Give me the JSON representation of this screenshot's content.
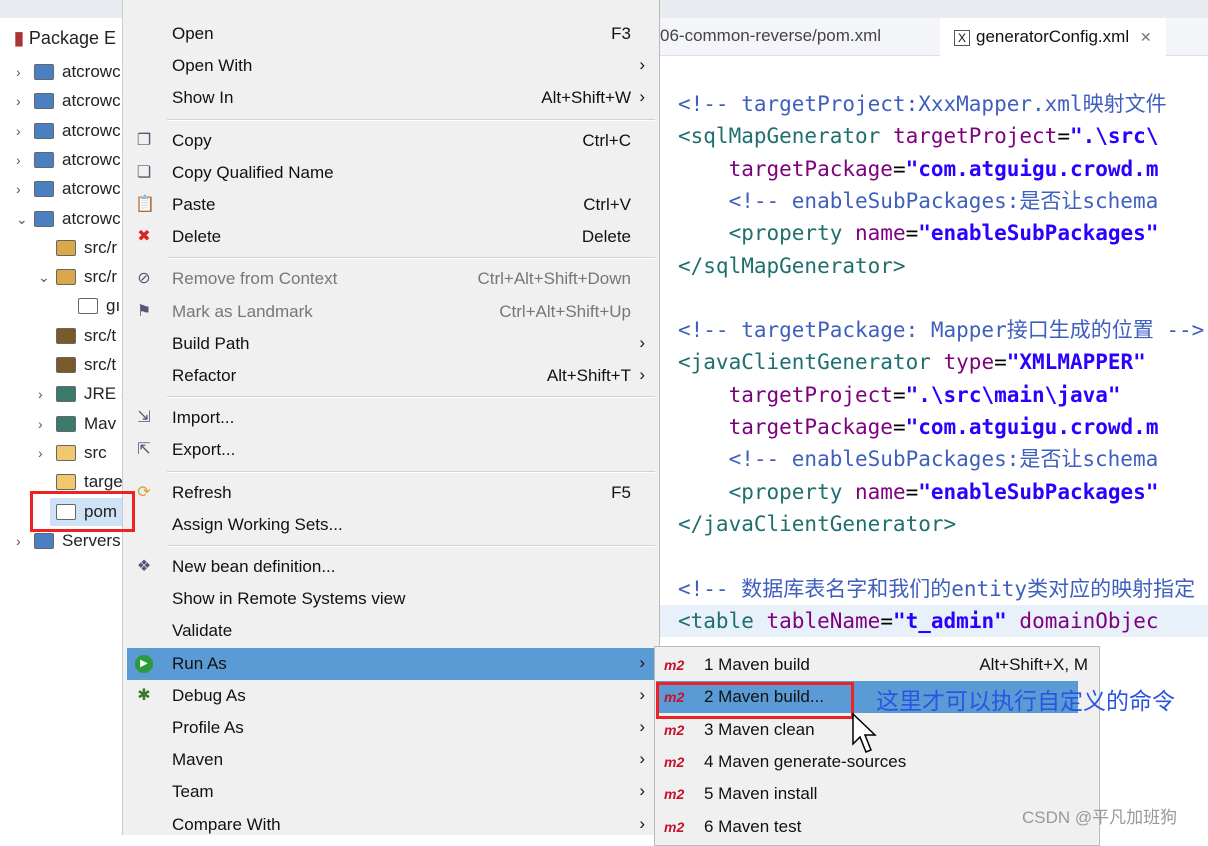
{
  "package_explorer": {
    "title": "Package E",
    "items": [
      {
        "twisty": "›",
        "label": "atcrowc",
        "icon": "maven-project-icon",
        "indent": 0
      },
      {
        "twisty": "›",
        "label": "atcrowc",
        "icon": "maven-project-icon",
        "indent": 0
      },
      {
        "twisty": "›",
        "label": "atcrowc",
        "icon": "maven-project-icon",
        "indent": 0
      },
      {
        "twisty": "›",
        "label": "atcrowc",
        "icon": "maven-project-icon",
        "indent": 0
      },
      {
        "twisty": "›",
        "label": "atcrowc",
        "icon": "maven-project-icon",
        "indent": 0
      },
      {
        "twisty": "⌄",
        "label": "atcrowc",
        "icon": "maven-project-icon",
        "indent": 0
      },
      {
        "twisty": "",
        "label": "src/r",
        "icon": "source-folder-icon",
        "indent": 1
      },
      {
        "twisty": "⌄",
        "label": "src/r",
        "icon": "source-folder-icon",
        "indent": 1
      },
      {
        "twisty": "",
        "label": "gı",
        "icon": "xml-file-icon",
        "indent": 2
      },
      {
        "twisty": "",
        "label": "src/t",
        "icon": "test-folder-icon",
        "indent": 1
      },
      {
        "twisty": "",
        "label": "src/t",
        "icon": "test-folder-icon",
        "indent": 1
      },
      {
        "twisty": "›",
        "label": "JRE S",
        "icon": "library-icon",
        "indent": 1
      },
      {
        "twisty": "›",
        "label": "Mav",
        "icon": "library-icon",
        "indent": 1
      },
      {
        "twisty": "›",
        "label": "src",
        "icon": "folder-icon",
        "indent": 1
      },
      {
        "twisty": "",
        "label": "targe",
        "icon": "folder-icon",
        "indent": 1
      },
      {
        "twisty": "",
        "label": "pom",
        "icon": "pom-file-icon",
        "indent": 1,
        "selected": true
      },
      {
        "twisty": "›",
        "label": "Servers",
        "icon": "project-icon",
        "indent": 0
      }
    ]
  },
  "editor": {
    "tabs": [
      {
        "label": "06-common-reverse/pom.xml",
        "active": false
      },
      {
        "label": "generatorConfig.xml",
        "active": true,
        "close": "✕"
      }
    ],
    "lines": [
      [
        [
          "c",
          "<!-- targetProject:XxxMapper.xml映射文件"
        ]
      ],
      [
        [
          "t",
          "<sqlMapGenerator "
        ],
        [
          "a",
          "targetProject"
        ],
        [
          "p",
          "="
        ],
        [
          "v",
          "\".\\src\\"
        ]
      ],
      [
        [
          "p",
          "    "
        ],
        [
          "a",
          "targetPackage"
        ],
        [
          "p",
          "="
        ],
        [
          "v",
          "\"com.atguigu.crowd.m"
        ]
      ],
      [
        [
          "p",
          "    "
        ],
        [
          "c",
          "<!-- enableSubPackages:是否让schema"
        ]
      ],
      [
        [
          "p",
          "    "
        ],
        [
          "t",
          "<property "
        ],
        [
          "a",
          "name"
        ],
        [
          "p",
          "="
        ],
        [
          "v",
          "\"enableSubPackages\""
        ]
      ],
      [
        [
          "t",
          "</sqlMapGenerator>"
        ]
      ],
      [
        [
          "p",
          ""
        ]
      ],
      [
        [
          "c",
          "<!-- targetPackage: Mapper接口生成的位置 -->"
        ]
      ],
      [
        [
          "t",
          "<javaClientGenerator "
        ],
        [
          "a",
          "type"
        ],
        [
          "p",
          "="
        ],
        [
          "v",
          "\"XMLMAPPER\""
        ]
      ],
      [
        [
          "p",
          "    "
        ],
        [
          "a",
          "targetProject"
        ],
        [
          "p",
          "="
        ],
        [
          "v",
          "\".\\src\\main\\java\""
        ]
      ],
      [
        [
          "p",
          "    "
        ],
        [
          "a",
          "targetPackage"
        ],
        [
          "p",
          "="
        ],
        [
          "v",
          "\"com.atguigu.crowd.m"
        ]
      ],
      [
        [
          "p",
          "    "
        ],
        [
          "c",
          "<!-- enableSubPackages:是否让schema"
        ]
      ],
      [
        [
          "p",
          "    "
        ],
        [
          "t",
          "<property "
        ],
        [
          "a",
          "name"
        ],
        [
          "p",
          "="
        ],
        [
          "v",
          "\"enableSubPackages\""
        ]
      ],
      [
        [
          "t",
          "</javaClientGenerator>"
        ]
      ],
      [
        [
          "p",
          ""
        ]
      ],
      [
        [
          "c",
          "<!-- 数据库表名字和我们的entity类对应的映射指定"
        ]
      ],
      [
        [
          "t",
          "<table "
        ],
        [
          "a",
          "tableName"
        ],
        [
          "p",
          "="
        ],
        [
          "v",
          "\"t_admin\""
        ],
        [
          "p",
          " "
        ],
        [
          "a",
          "domainObjec"
        ]
      ]
    ]
  },
  "context_menu": {
    "items": [
      {
        "label": "Open",
        "shortcut": "F3"
      },
      {
        "label": "Open With",
        "submenu": true
      },
      {
        "label": "Show In",
        "shortcut": "Alt+Shift+W",
        "submenu": true
      },
      {
        "sep": true
      },
      {
        "label": "Copy",
        "shortcut": "Ctrl+C",
        "icon": "copy-icon"
      },
      {
        "label": "Copy Qualified Name",
        "icon": "copy-qualified-name-icon"
      },
      {
        "label": "Paste",
        "shortcut": "Ctrl+V",
        "icon": "paste-icon"
      },
      {
        "label": "Delete",
        "shortcut": "Delete",
        "icon": "delete-icon"
      },
      {
        "sep": true
      },
      {
        "label": "Remove from Context",
        "shortcut": "Ctrl+Alt+Shift+Down",
        "icon": "remove-context-icon",
        "disabled": true
      },
      {
        "label": "Mark as Landmark",
        "shortcut": "Ctrl+Alt+Shift+Up",
        "icon": "landmark-icon",
        "disabled": true
      },
      {
        "label": "Build Path",
        "submenu": true
      },
      {
        "label": "Refactor",
        "shortcut": "Alt+Shift+T",
        "submenu": true
      },
      {
        "sep": true
      },
      {
        "label": "Import...",
        "icon": "import-icon"
      },
      {
        "label": "Export...",
        "icon": "export-icon"
      },
      {
        "sep": true
      },
      {
        "label": "Refresh",
        "shortcut": "F5",
        "icon": "refresh-icon"
      },
      {
        "label": "Assign Working Sets..."
      },
      {
        "sep": true
      },
      {
        "label": "New bean definition...",
        "icon": "bean-icon"
      },
      {
        "label": "Show in Remote Systems view"
      },
      {
        "label": "Validate"
      },
      {
        "label": "Run As",
        "submenu": true,
        "icon": "run-icon",
        "highlighted": true
      },
      {
        "label": "Debug As",
        "submenu": true,
        "icon": "debug-icon"
      },
      {
        "label": "Profile As",
        "submenu": true
      },
      {
        "label": "Maven",
        "submenu": true
      },
      {
        "label": "Team",
        "submenu": true
      },
      {
        "label": "Compare With",
        "submenu": true
      }
    ]
  },
  "run_as_submenu": {
    "badge": "m2",
    "items": [
      {
        "label": "1 Maven build",
        "shortcut": "Alt+Shift+X, M"
      },
      {
        "label": "2 Maven build...",
        "highlighted": true
      },
      {
        "label": "3 Maven clean"
      },
      {
        "label": "4 Maven generate-sources"
      },
      {
        "label": "5 Maven install"
      },
      {
        "label": "6 Maven test"
      }
    ]
  },
  "annotation": {
    "text": "这里才可以执行自定义的命令",
    "color": "#2a55e0"
  },
  "watermark": "CSDN @平凡加班狗",
  "colors": {
    "highlight": "#5b9bd5",
    "annotation_box": "#ee2222",
    "maven_badge": "#c8102e"
  }
}
